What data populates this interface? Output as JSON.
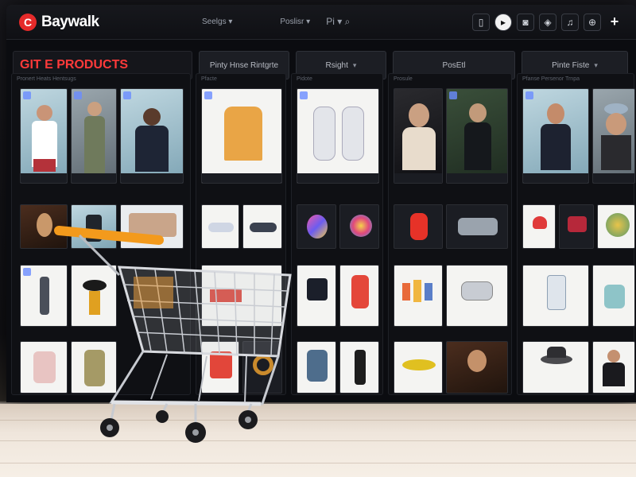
{
  "app": {
    "logo_text": "Baywalk",
    "logo_mark": "C"
  },
  "topbar": {
    "nav": [
      {
        "label": "Seelgs ▾"
      },
      {
        "label": "Poslisr ▾"
      },
      {
        "label": "Pi ▾"
      }
    ],
    "search_icon": "search-icon",
    "icons": [
      "trash-icon",
      "info-icon",
      "camera-icon",
      "tag-icon",
      "bell-icon",
      "globe-icon",
      "plus-icon"
    ]
  },
  "filters": {
    "section_title": "GIT E PRODUCTS",
    "items": [
      {
        "label": "Pinty Hnse Rintgrte"
      },
      {
        "label": "Rsight",
        "chevron": "▾"
      },
      {
        "label": "PosEtl"
      },
      {
        "label": "Pinte Fiste",
        "chevron": "▾"
      }
    ]
  },
  "columns": [
    {
      "head": "Pronert      Heats Hentsugs"
    },
    {
      "head": "Pfacte"
    },
    {
      "head": "Pidote"
    },
    {
      "head": "Prosule"
    },
    {
      "head": "Pfanse       Persenor Trnpa"
    }
  ],
  "colors": {
    "accent_red": "#ff3a3a",
    "logo_red": "#e52a2a",
    "badge_blue": "#6a8cff",
    "cart_handle": "#f39a1c"
  }
}
